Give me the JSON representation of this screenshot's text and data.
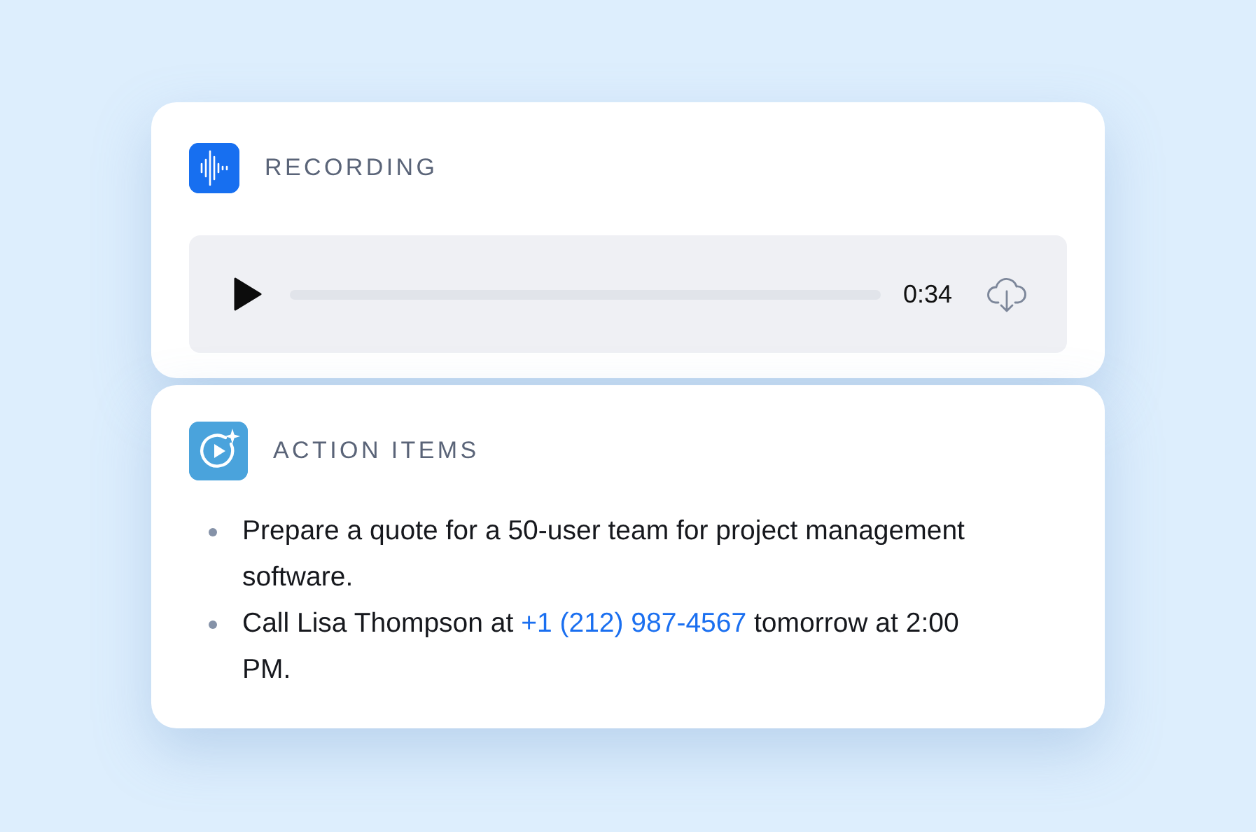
{
  "recording": {
    "title": "RECORDING",
    "player": {
      "time": "0:34"
    }
  },
  "action_items": {
    "title": "ACTION ITEMS",
    "items": [
      {
        "parts": [
          {
            "kind": "text",
            "text": "Prepare a quote for a 50-user team for project management software."
          }
        ]
      },
      {
        "parts": [
          {
            "kind": "text",
            "text": "Call Lisa Thompson at "
          },
          {
            "kind": "link",
            "text": "+1 (212) 987-4567"
          },
          {
            "kind": "text",
            "text": " tomorrow at 2:00 PM."
          }
        ]
      }
    ]
  }
}
